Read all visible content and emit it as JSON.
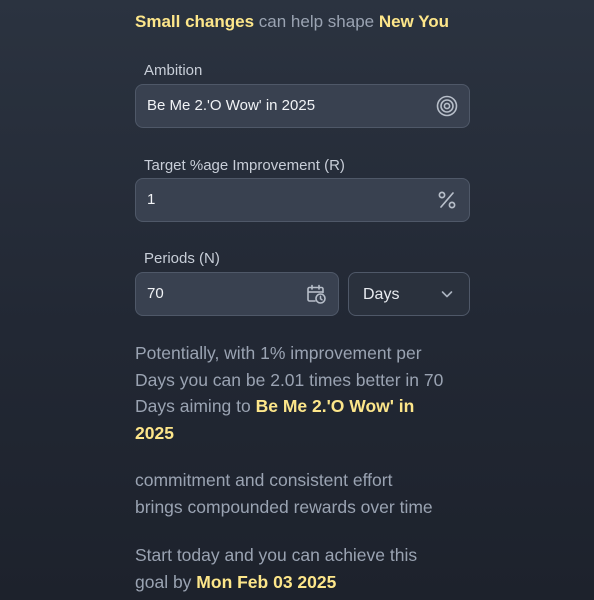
{
  "header": {
    "part1": "Small changes",
    "part2": " can help shape ",
    "part3": "New You"
  },
  "ambition": {
    "label": "Ambition",
    "value": "Be Me 2.'O Wow' in 2025",
    "icon": "target-icon"
  },
  "target": {
    "label": "Target %age Improvement (R)",
    "value": "1",
    "icon": "percent-icon"
  },
  "periods": {
    "label": "Periods (N)",
    "value": "70",
    "icon": "calendar-clock-icon",
    "unit_selected": "Days"
  },
  "result": {
    "line1": "Potentially, with 1% improvement per",
    "line2": "Days you can be 2.01 times better in 70",
    "line3_prefix": "Days aiming to ",
    "line3_goal": "Be Me 2.'O Wow' in",
    "line4_goal": "2025"
  },
  "commitment": {
    "line1": "commitment and consistent effort",
    "line2": "brings compounded rewards over time"
  },
  "start": {
    "line1": "Start today and you can achieve this",
    "line2_prefix": "goal by ",
    "date": "Mon Feb 03 2025"
  },
  "colors": {
    "accent": "#fde68a",
    "field_bg": "#394150",
    "text_muted": "#9aa3b2"
  }
}
